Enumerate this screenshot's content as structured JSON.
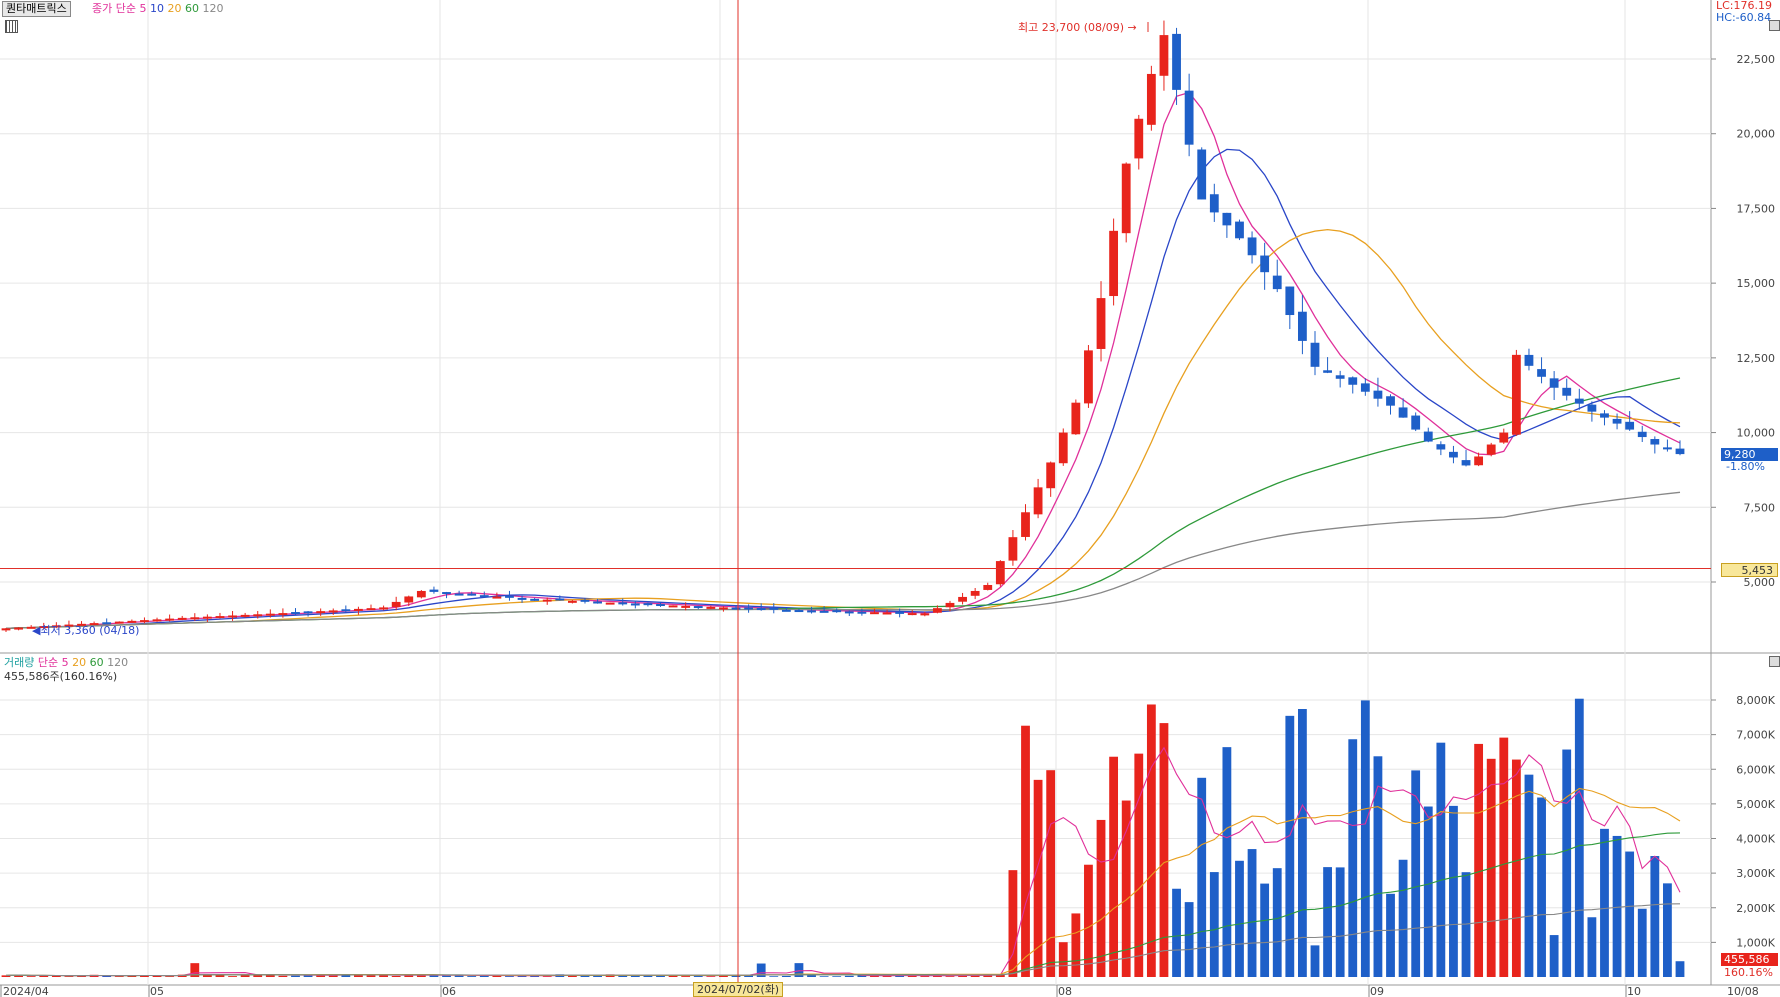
{
  "title_tab": "퀀타매트릭스",
  "price_legend": {
    "prefix": "종가 단순",
    "periods": [
      {
        "label": "5",
        "color": "#e0309a"
      },
      {
        "label": "10",
        "color": "#2a46c8"
      },
      {
        "label": "20",
        "color": "#e8a020"
      },
      {
        "label": "60",
        "color": "#2e9a3a"
      },
      {
        "label": "120",
        "color": "#888888"
      }
    ]
  },
  "volume_legend": {
    "prefix": "거래량",
    "prefix_color": "#1ea0a0",
    "ma_prefix": "단순",
    "periods": [
      {
        "label": "5",
        "color": "#e0309a"
      },
      {
        "label": "20",
        "color": "#e8a020"
      },
      {
        "label": "60",
        "color": "#2e9a3a"
      },
      {
        "label": "120",
        "color": "#888888"
      }
    ],
    "current": "455,586주(160.16%)"
  },
  "lc_hc": {
    "lc": "LC:176.19",
    "hc": "HC:-60.84"
  },
  "annotations": {
    "high": "최고 23,700 (08/09)",
    "low": "최저 3,360 (04/18)"
  },
  "price_tag": {
    "value": "9,280",
    "change": "-1.80%"
  },
  "hline_tag": "5,453",
  "volume_tag": {
    "value": "455,586",
    "pct": "160.16%"
  },
  "cursor_date": "2024/07/02(화)",
  "colors": {
    "up": "#e8241c",
    "down": "#1e5fc8",
    "hline": "#e0302a",
    "cursor": "#e0302a"
  },
  "chart_data": [
    {
      "type": "candlestick",
      "title": "",
      "x_labels": [
        "2024/04",
        "05",
        "06",
        "08",
        "09",
        "10",
        "10/08"
      ],
      "y_ticks": [
        "22,500",
        "20,000",
        "17,500",
        "15,000",
        "12,500",
        "10,000",
        "7,500",
        "5,000"
      ],
      "ylim": [
        3000,
        24200
      ],
      "hline": 5453,
      "candles_sample": [
        {
          "date": "08/01",
          "open": 9000,
          "high": 9600,
          "low": 8900,
          "close": 9400
        },
        {
          "date": "08/09",
          "open": 21000,
          "high": 23700,
          "low": 19600,
          "close": 23300
        },
        {
          "date": "10/08",
          "open": 9400,
          "high": 9400,
          "low": 9200,
          "close": 9280
        }
      ],
      "ma": [
        "5",
        "10",
        "20",
        "60",
        "120"
      ]
    },
    {
      "type": "bar",
      "title": "",
      "y_ticks": [
        "8,000K",
        "7,000K",
        "6,000K",
        "5,000K",
        "4,000K",
        "3,000K",
        "2,000K",
        "1,000K"
      ],
      "ylim": [
        0,
        8800
      ],
      "unit": "K",
      "last_value": 455.586
    }
  ]
}
